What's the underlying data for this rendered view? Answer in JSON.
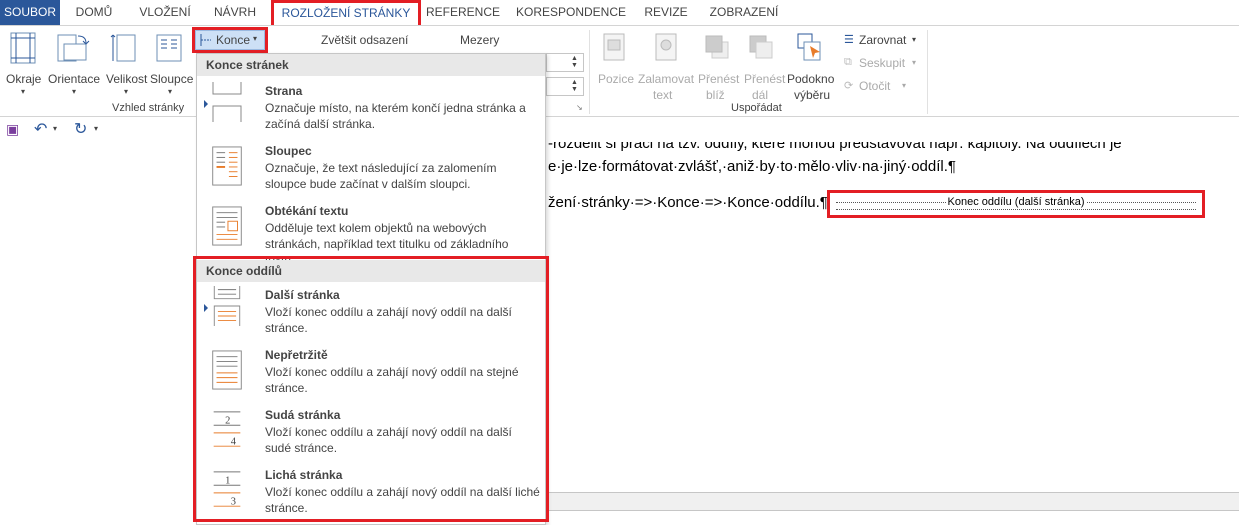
{
  "tabs": [
    {
      "label": "SOUBOR"
    },
    {
      "label": "DOMŮ"
    },
    {
      "label": "VLOŽENÍ"
    },
    {
      "label": "NÁVRH"
    },
    {
      "label": "ROZLOŽENÍ STRÁNKY"
    },
    {
      "label": "REFERENCE"
    },
    {
      "label": "KORESPONDENCE"
    },
    {
      "label": "REVIZE"
    },
    {
      "label": "ZOBRAZENÍ"
    }
  ],
  "ribbon": {
    "page_setup": {
      "okraje": "Okraje",
      "orientace": "Orientace",
      "velikost": "Velikost",
      "sloupce": "Sloupce",
      "group_label": "Vzhled stránky"
    },
    "konce_button": "Konce",
    "indent_label": "Zvětšit odsazení",
    "spacing_label": "Mezery",
    "arrange": {
      "pozice": "Pozice",
      "zalamovat_1": "Zalamovat",
      "zalamovat_2": "text",
      "prenest_blize_1": "Přenést",
      "prenest_blize_2": "blíž",
      "prenest_dal_1": "Přenést",
      "prenest_dal_2": "dál",
      "podokno_1": "Podokno",
      "podokno_2": "výběru",
      "zarovnat": "Zarovnat",
      "seskupit": "Seskupit",
      "otocit": "Otočit",
      "group_label": "Uspořádat"
    }
  },
  "document": {
    "line1": "-rozdělit si práci na tzv. oddíly, které mohou představovat např. kapitoly. Na oddílech je",
    "line2": "e·je·lze·formátovat·zvlášť,·aniž·by·to·mělo·vliv·na·jiný·oddíl.¶",
    "line3": "žení·stránky·=>·Konce·=>·Konce·oddílu.¶",
    "section_break_label": "Konec oddílu (další stránka)"
  },
  "dropdown": {
    "page_breaks_header": "Konce stránek",
    "section_breaks_header": "Konce oddílů",
    "items": [
      {
        "title": "Strana",
        "desc": "Označuje místo, na kterém končí jedna stránka a začíná další stránka.",
        "icon": "page-break-icon"
      },
      {
        "title": "Sloupec",
        "desc": "Označuje, že text následující za zalomením sloupce bude začínat v dalším sloupci.",
        "icon": "column-break-icon"
      },
      {
        "title": "Obtékání textu",
        "desc": "Odděluje text kolem objektů na webových stránkách, například text titulku od základního textu.",
        "icon": "text-wrap-break-icon"
      },
      {
        "title": "Další stránka",
        "desc": "Vloží konec oddílu a zahájí nový oddíl na další stránce.",
        "icon": "next-page-section-icon"
      },
      {
        "title": "Nepřetržitě",
        "desc": "Vloží konec oddílu a zahájí nový oddíl na stejné stránce.",
        "icon": "continuous-section-icon"
      },
      {
        "title": "Sudá stránka",
        "desc": "Vloží konec oddílu a zahájí nový oddíl na další sudé stránce.",
        "icon": "even-page-section-icon"
      },
      {
        "title": "Lichá stránka",
        "desc": "Vloží konec oddílu a zahájí nový oddíl na další liché stránce.",
        "icon": "odd-page-section-icon"
      }
    ]
  },
  "colors": {
    "accent": "#2b579a",
    "highlight": "#e31e24",
    "orange": "#e87c2a"
  }
}
